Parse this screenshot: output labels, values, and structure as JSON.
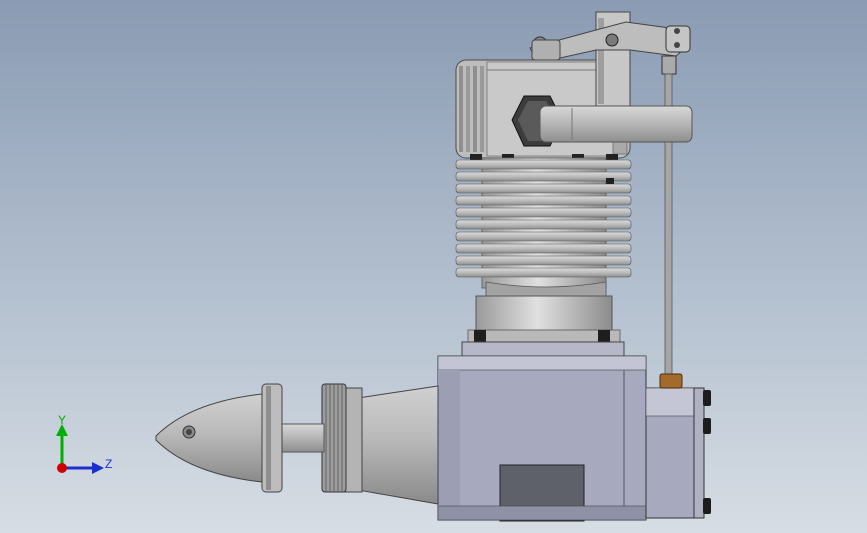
{
  "triad": {
    "y_label": "Y",
    "z_label": "Z",
    "colors": {
      "y": "#00b000",
      "z": "#1a2fd0",
      "origin": "#d00000"
    }
  },
  "model": {
    "kind": "engine-side-view",
    "colors": {
      "metal_light": "#c8c8c8",
      "metal_mid": "#a9a9a9",
      "metal_dark": "#6e6e6e",
      "crankcase": "#a7a9bf",
      "sump": "#5e6169",
      "bolt": "#1b1b1b",
      "brass": "#a36a2c"
    }
  }
}
